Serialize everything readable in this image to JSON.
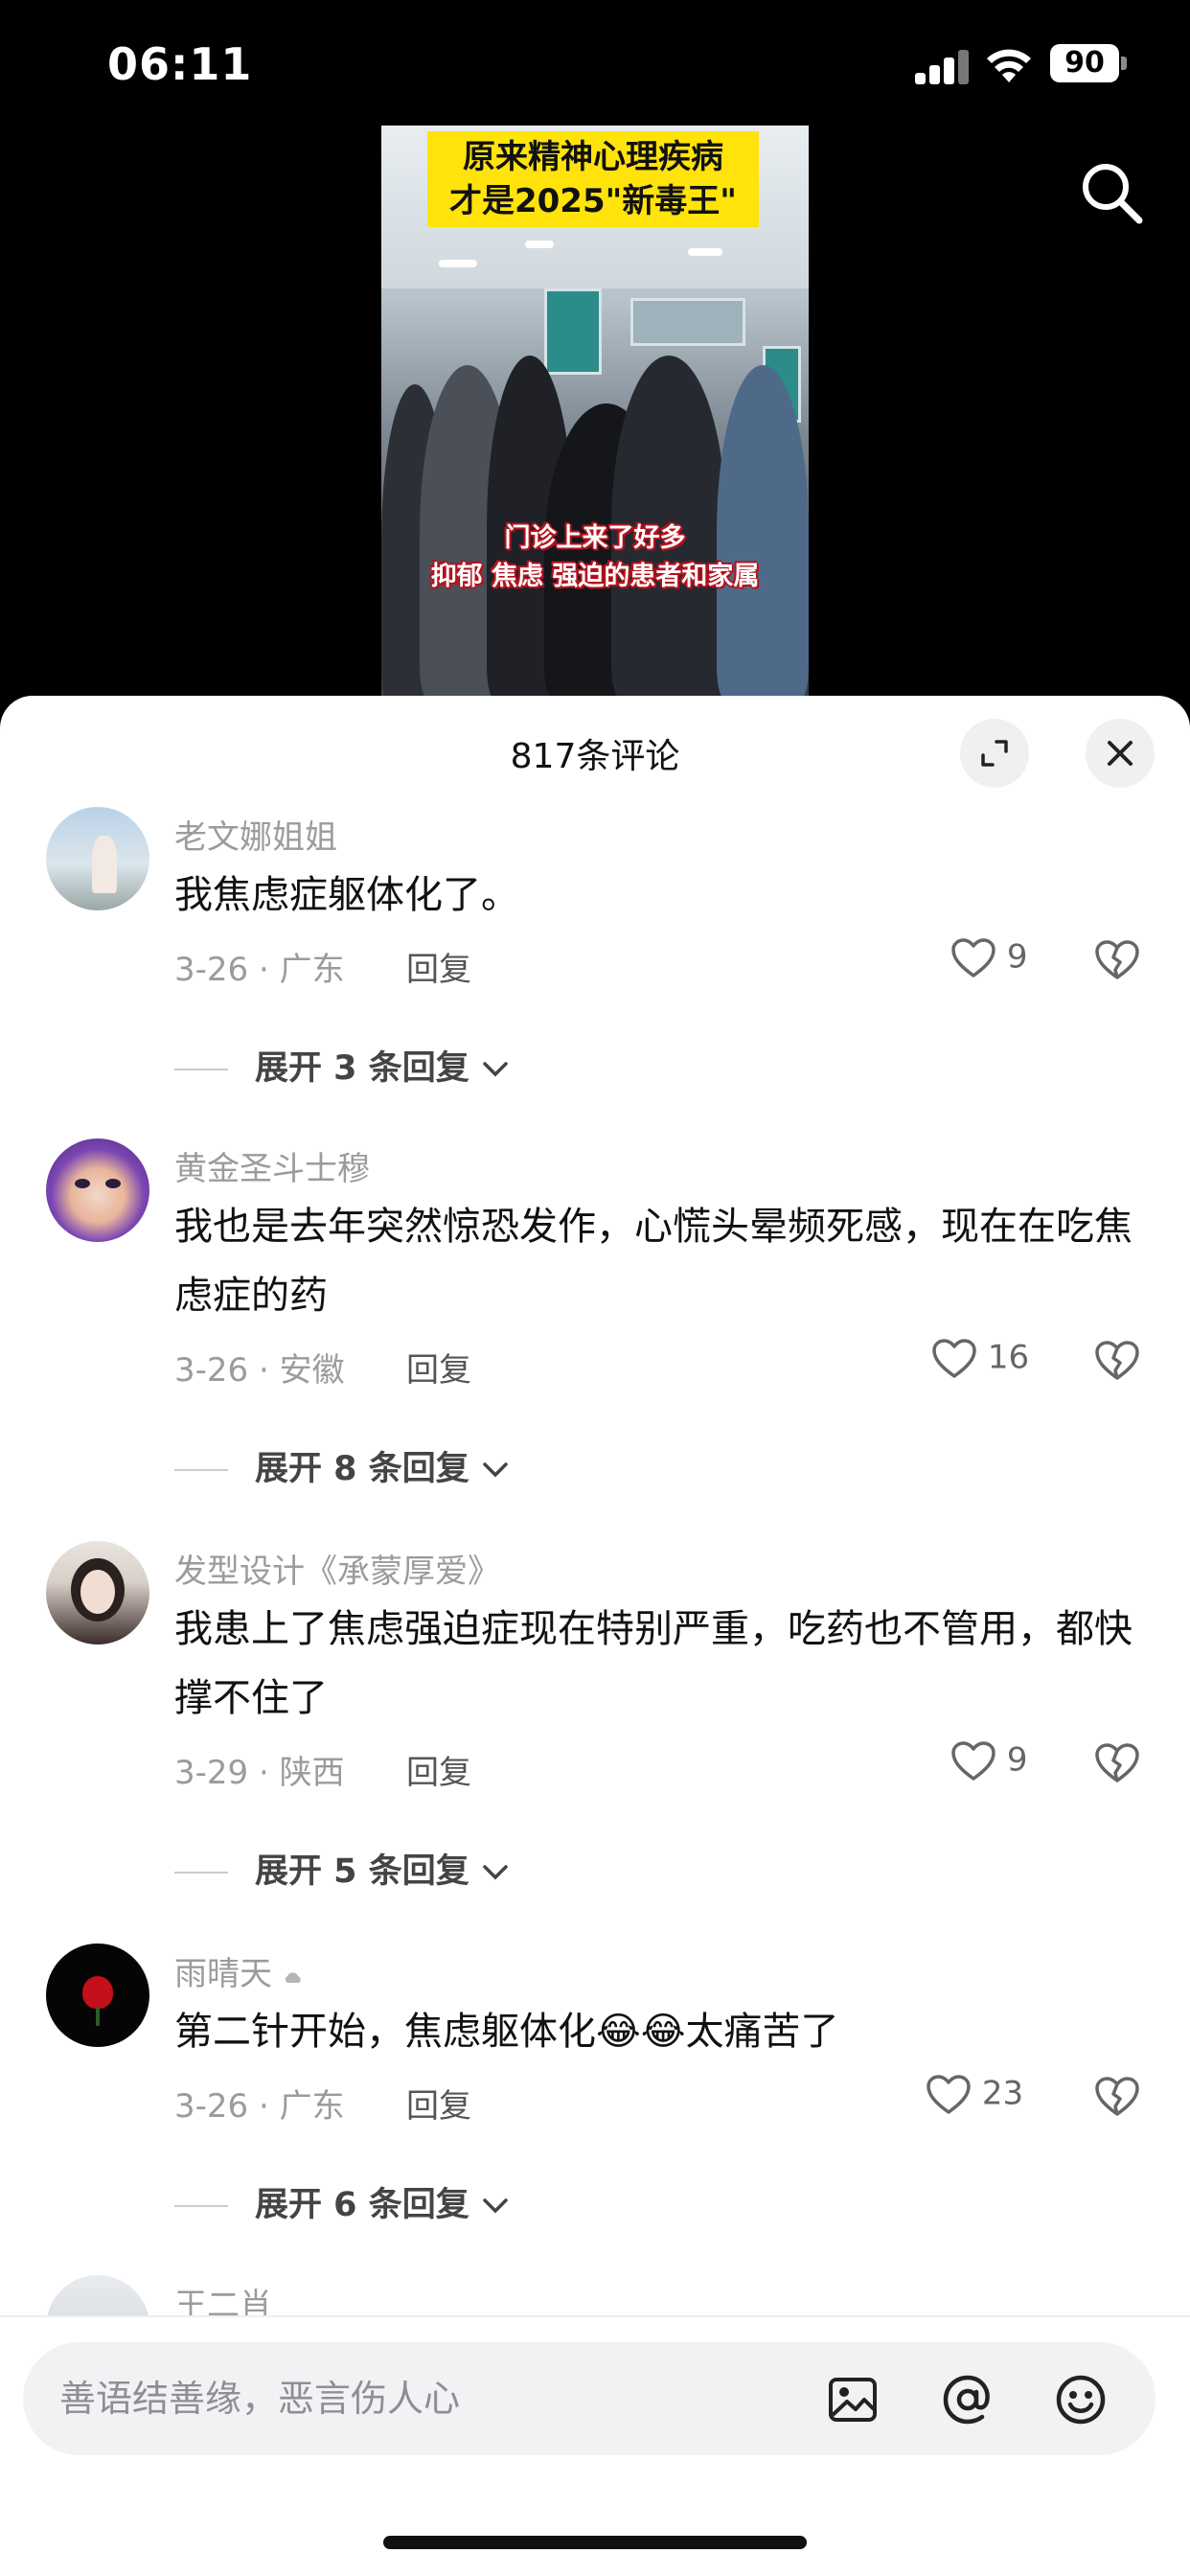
{
  "status_bar": {
    "time": "06:11",
    "battery": "90"
  },
  "video": {
    "title_line1": "原来精神心理疾病",
    "title_line2": "才是2025\"新毒王\"",
    "subtitle_line1": "门诊上来了好多",
    "subtitle_line2": "抑郁 焦虑 强迫的患者和家属"
  },
  "comments_sheet": {
    "title": "817条评论",
    "comments": [
      {
        "username": "老文娜姐姐",
        "text": "我焦虑症躯体化了。",
        "date_location": "3-26 · 广东",
        "reply_label": "回复",
        "likes": "9",
        "expand_label": "展开 3 条回复"
      },
      {
        "username": "黄金圣斗士穆",
        "text": "我也是去年突然惊恐发作，心慌头晕频死感，现在在吃焦虑症的药",
        "date_location": "3-26 · 安徽",
        "reply_label": "回复",
        "likes": "16",
        "expand_label": "展开 8 条回复"
      },
      {
        "username": "发型设计《承蒙厚爱》",
        "text": "我患上了焦虑强迫症现在特别严重，吃药也不管用，都快撑不住了",
        "date_location": "3-29 · 陕西",
        "reply_label": "回复",
        "likes": "9",
        "expand_label": "展开 5 条回复"
      },
      {
        "username": "雨晴天",
        "text": "第二针开始，焦虑躯体化😂😂太痛苦了",
        "date_location": "3-26 · 广东",
        "reply_label": "回复",
        "likes": "23",
        "expand_label": "展开 6 条回复"
      },
      {
        "username": "王二肖"
      }
    ]
  },
  "input": {
    "placeholder": "善语结善缘，恶言伤人心"
  },
  "colors": {
    "accent_yellow": "#ffe30a",
    "muted_text": "#9b9b9f",
    "sheet_bg": "#ffffff"
  }
}
